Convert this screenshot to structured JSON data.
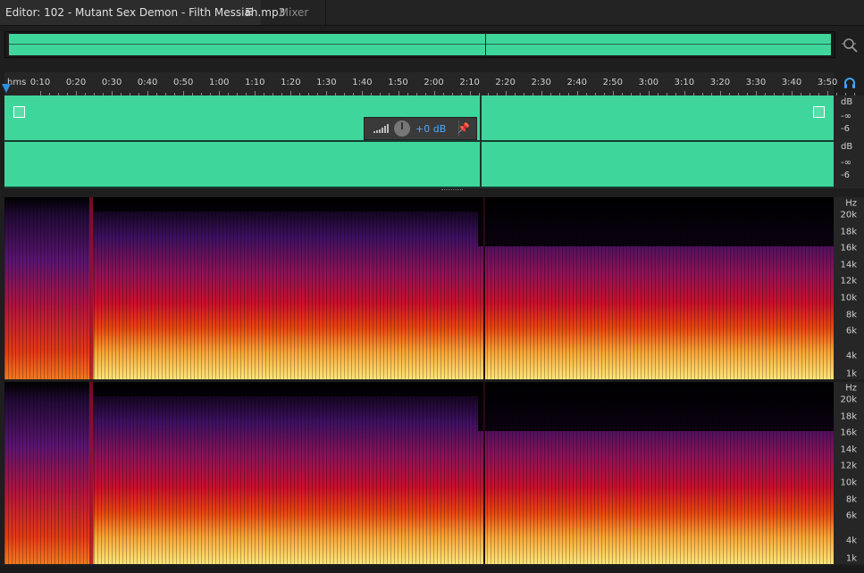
{
  "tabs": {
    "editor_label": "Editor: 102 - Mutant Sex Demon - Filth Messiah.mp3",
    "mixer_label": "Mixer"
  },
  "ruler": {
    "unit": "hms",
    "ticks": [
      "0:10",
      "0:20",
      "0:30",
      "0:40",
      "0:50",
      "1:00",
      "1:10",
      "1:20",
      "1:30",
      "1:40",
      "1:50",
      "2:00",
      "2:10",
      "2:20",
      "2:30",
      "2:40",
      "2:50",
      "3:00",
      "3:10",
      "3:20",
      "3:30",
      "3:40",
      "3:50"
    ]
  },
  "hud": {
    "gain": "+0 dB"
  },
  "waveform_scale": {
    "ch1": [
      "dB",
      "-∞",
      "-6"
    ],
    "ch2": [
      "dB",
      "-∞",
      "-6"
    ]
  },
  "spectral_scale": [
    "Hz",
    "20k",
    "18k",
    "16k",
    "14k",
    "12k",
    "10k",
    "8k",
    "6k",
    "4k",
    "1k"
  ],
  "colors": {
    "waveform": "#3fd69c",
    "accent": "#4aa9ff",
    "playhead_marker": "#2d8fe0"
  },
  "icons": {
    "zoom": "zoom-selection-icon",
    "headphones": "headphones-icon",
    "pin": "pin-icon",
    "menu": "menu-icon"
  }
}
